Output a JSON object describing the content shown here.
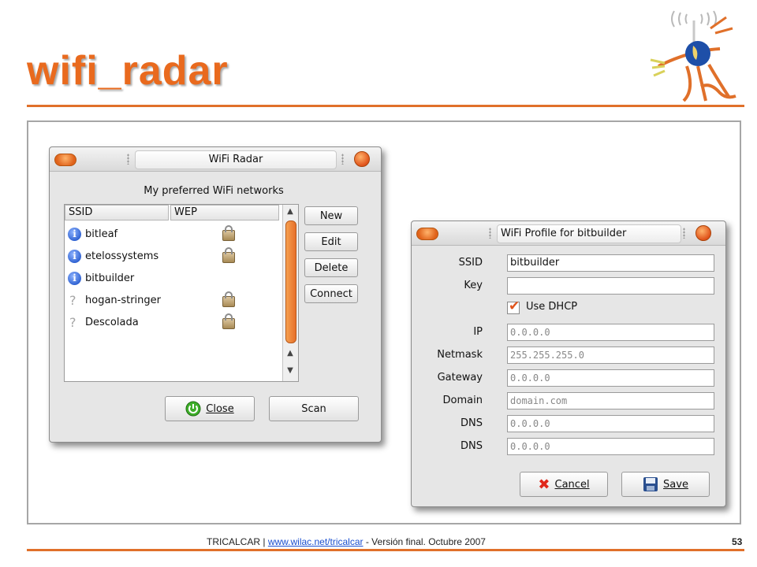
{
  "slide": {
    "title": "wifi_radar",
    "footer_org": "TRICALCAR",
    "footer_sep1": " | ",
    "footer_link": "www.wilac.net/tricalcar",
    "footer_rest": " - Versión final. Octubre 2007",
    "page_number": "53"
  },
  "radar_window": {
    "title": "WiFi Radar",
    "heading": "My preferred WiFi networks",
    "col_ssid": "SSID",
    "col_wep": "WEP",
    "networks": [
      {
        "name": "bitleaf",
        "known": true,
        "wep": true
      },
      {
        "name": "etelossystems",
        "known": true,
        "wep": true
      },
      {
        "name": "bitbuilder",
        "known": true,
        "wep": false
      },
      {
        "name": "hogan-stringer",
        "known": false,
        "wep": true
      },
      {
        "name": "Descolada",
        "known": false,
        "wep": true
      }
    ],
    "buttons": {
      "new": "New",
      "edit": "Edit",
      "delete": "Delete",
      "connect": "Connect"
    },
    "close_label": "Close",
    "scan_label": "Scan"
  },
  "profile_window": {
    "title": "WiFi Profile for bitbuilder",
    "labels": {
      "ssid": "SSID",
      "key": "Key",
      "ip": "IP",
      "netmask": "Netmask",
      "gateway": "Gateway",
      "domain": "Domain",
      "dns1": "DNS",
      "dns2": "DNS"
    },
    "values": {
      "ssid": "bitbuilder",
      "key": "",
      "ip": "0.0.0.0",
      "netmask": "255.255.255.0",
      "gateway": "0.0.0.0",
      "domain": "domain.com",
      "dns1": "0.0.0.0",
      "dns2": "0.0.0.0"
    },
    "use_dhcp_label": "Use DHCP",
    "use_dhcp_checked": true,
    "cancel_label": "Cancel",
    "save_label": "Save"
  },
  "colors": {
    "accent": "#e96a1e",
    "link": "#1a4fd0"
  }
}
